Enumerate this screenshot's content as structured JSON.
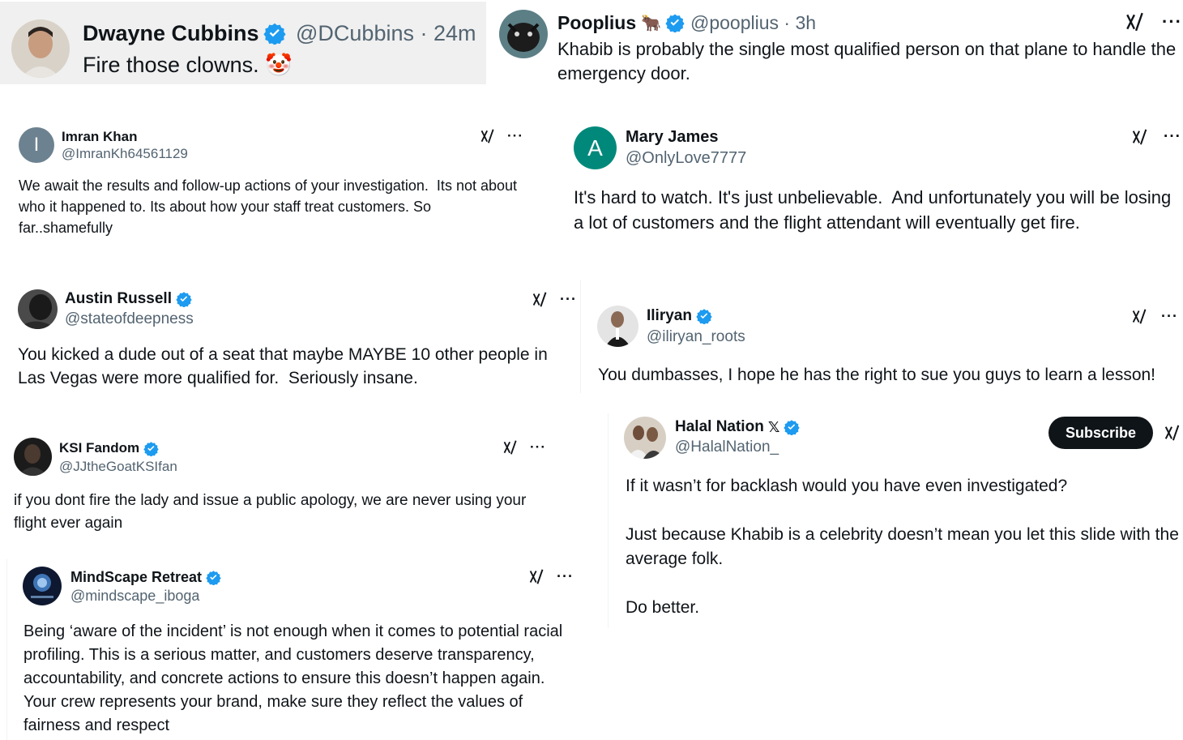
{
  "colors": {
    "verified": "#1d9bf0",
    "text": "#0f1419",
    "muted": "#536471"
  },
  "tweets": {
    "dwayne": {
      "name": "Dwayne Cubbins",
      "handle": "@DCubbins · 24m",
      "text": "Fire those clowns. 🤡"
    },
    "pooplius": {
      "name": "Pooplius",
      "name_emoji": "🐂",
      "handle": "@pooplius · 3h",
      "text": "Khabib is probably the single most qualified person on that plane to handle the emergency door."
    },
    "imran": {
      "name": "Imran Khan",
      "avatar_letter": "I",
      "handle": "@ImranKh64561129",
      "text": "We await the results and follow-up actions of your investigation.  Its not about who it happened to. Its about how your staff treat customers. So far..shamefully"
    },
    "mary": {
      "name": "Mary James",
      "avatar_letter": "A",
      "handle": "@OnlyLove7777",
      "text": "It's hard to watch. It's just unbelievable.  And unfortunately you will be losing a lot of customers and the flight attendant will eventually get fire."
    },
    "austin": {
      "name": "Austin Russell",
      "handle": "@stateofdeepness",
      "text": "You kicked a dude out of a seat that maybe MAYBE 10 other people in Las Vegas were more qualified for.  Seriously insane."
    },
    "iliryan": {
      "name": "Iliryan",
      "handle": "@iliryan_roots",
      "text": "You dumbasses, I hope he has the right to sue you guys to learn a lesson!"
    },
    "ksi": {
      "name": "KSI Fandom",
      "handle": "@JJtheGoatKSIfan",
      "text": "if you dont fire the lady and issue a public apology, we are never using your flight ever again"
    },
    "halal": {
      "name": "Halal Nation",
      "name_emoji": "𝕏",
      "handle": "@HalalNation_",
      "subscribe": "Subscribe",
      "text": "If it wasn’t for backlash would you have even investigated?\n\nJust because Khabib is a celebrity doesn’t mean you let this slide with the average folk.\n\nDo better."
    },
    "mindscape": {
      "name": "MindScape Retreat",
      "handle": "@mindscape_iboga",
      "text": "Being ‘aware of the incident’ is not enough when it comes to potential racial profiling. This is a serious matter, and customers deserve transparency, accountability, and concrete actions to ensure this doesn’t happen again. Your crew represents your brand, make sure they reflect the values of fairness and respect"
    }
  },
  "more_label": "···"
}
